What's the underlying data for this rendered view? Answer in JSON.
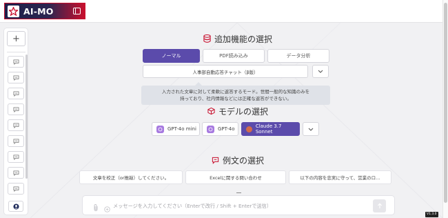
{
  "app": {
    "title": "AI-MO"
  },
  "sidebar": {
    "new_chat_label": "+",
    "chat_count": 10
  },
  "features": {
    "title": "追加機能の選択",
    "tabs": [
      {
        "label": "ノーマル",
        "active": true
      },
      {
        "label": "PDF読み込み",
        "active": false
      },
      {
        "label": "データ分析",
        "active": false
      }
    ],
    "selected_bot": "人事部自動応答チャット（β版）",
    "tooltip_line1": "入力された文章に対して柔軟に返答するモード。世間一般的な知識のみを",
    "tooltip_line2": "持っており、社内情報などには正確な返答ができない。"
  },
  "models": {
    "title": "モデルの選択",
    "items": [
      {
        "label": "GPT-4o mini",
        "active": false
      },
      {
        "label": "GPT-4o",
        "active": false
      },
      {
        "label": "Claude 3.7 Sonnet",
        "active": true
      }
    ]
  },
  "examples": {
    "title": "例文の選択",
    "items": [
      "文章を校正（or推敲）してください。",
      "Excelに関する問い合わせ",
      "以下の内容を忠実に守って、営業のロ…"
    ]
  },
  "input": {
    "placeholder": "メッセージを入力してください（Enterで改行 / Shift + Enterで送信）"
  },
  "version": "V1.3.0",
  "colors": {
    "accent": "#5b4bab",
    "brand_red": "#c8102e",
    "brand_dark": "#1e1f4a"
  }
}
